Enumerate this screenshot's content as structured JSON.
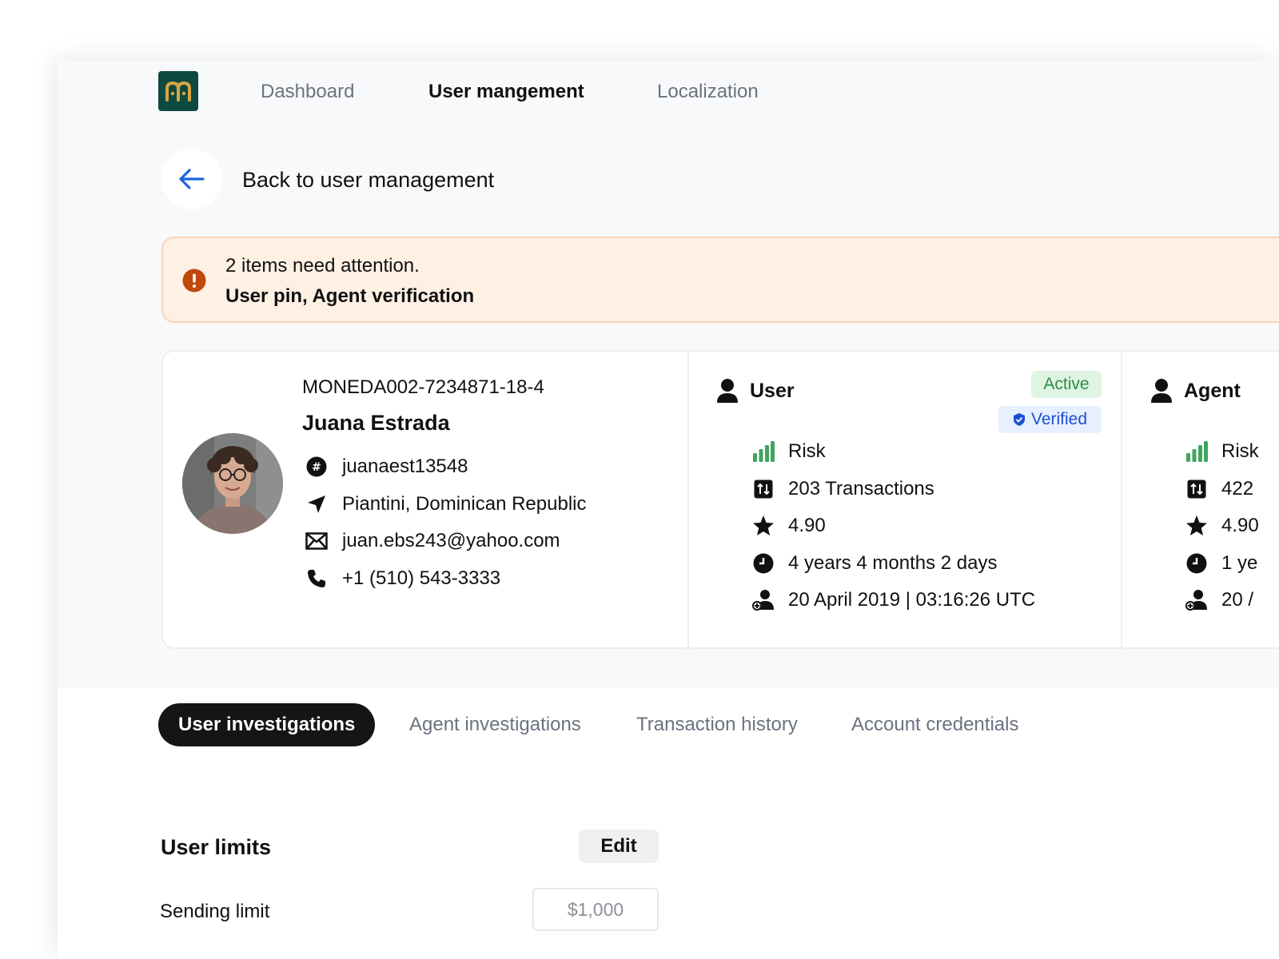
{
  "nav": {
    "logo_letter": "m",
    "items": [
      {
        "label": "Dashboard",
        "active": false
      },
      {
        "label": "User mangement",
        "active": true
      },
      {
        "label": "Localization",
        "active": false
      }
    ]
  },
  "back": {
    "label": "Back to user management"
  },
  "alert": {
    "title": "2 items need attention.",
    "items": "User pin, Agent verification"
  },
  "profile": {
    "account_id": "MONEDA002-7234871-18-4",
    "name": "Juana Estrada",
    "username": "juanaest13548",
    "location": "Piantini, Dominican Republic",
    "email": "juan.ebs243@yahoo.com",
    "phone": "+1 (510) 543-3333"
  },
  "user_section": {
    "title": "User",
    "status": "Active",
    "verified": "Verified",
    "risk": "Risk",
    "transactions": "203 Transactions",
    "rating": "4.90",
    "tenure": "4 years 4 months 2 days",
    "joined": "20 April 2019 | 03:16:26 UTC"
  },
  "agent_section": {
    "title": "Agent",
    "risk": "Risk",
    "transactions": "422",
    "rating": "4.90",
    "tenure": "1 ye",
    "joined": "20 /"
  },
  "tabs": [
    {
      "label": "User investigations",
      "active": true
    },
    {
      "label": "Agent investigations",
      "active": false
    },
    {
      "label": "Transaction history",
      "active": false
    },
    {
      "label": "Account credentials",
      "active": false
    }
  ],
  "limits": {
    "title": "User limits",
    "edit_label": "Edit",
    "sending_label": "Sending limit",
    "sending_placeholder": "$1,000"
  },
  "colors": {
    "brand": "#0e4a3f",
    "brand_accent": "#d9a441",
    "back_arrow": "#1a66e0",
    "alert_bg": "#fff0e4",
    "alert_icon": "#c2470b",
    "active_badge_bg": "#def5e3",
    "active_badge_text": "#2f8a48",
    "verified_badge_bg": "#e6f0ff",
    "verified_badge_text": "#1d4ed8",
    "risk_green": "#3fa55b"
  }
}
